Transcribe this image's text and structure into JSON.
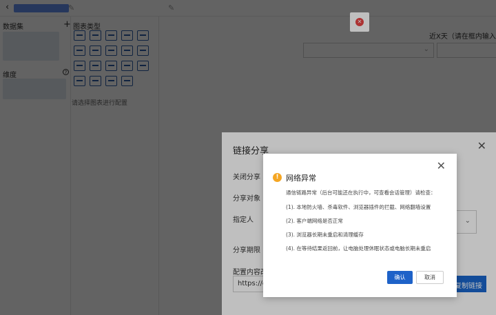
{
  "topbar": {
    "back_icon": "‹",
    "edit_icon": "✎"
  },
  "left_panel": {
    "dataset_title": "数据集",
    "add_icon": "+",
    "dimension_title": "维度",
    "help_icon": "?"
  },
  "chart_panel": {
    "title": "图表类型",
    "hint": "请选择图表进行配置",
    "chart_types": [
      "table",
      "crosstab",
      "list",
      "line",
      "bar",
      "horizontal-bar",
      "pie",
      "scatter",
      "funnel",
      "radar",
      "area",
      "gauge",
      "stacked-bar",
      "combo",
      "map",
      "ranking",
      "text",
      "kpi",
      "venn"
    ]
  },
  "main": {
    "recent_label": "近X天（请在框内输入要显",
    "select_chevron": "⌄"
  },
  "share_dialog": {
    "title": "链接分享",
    "close_icon": "✕",
    "close_share_label": "关闭分享",
    "target_label": "分享对象",
    "specify_label": "指定人",
    "period_label": "分享期限",
    "config_label": "配置内容改变",
    "url_value": "https://dm",
    "copy_button": "复制链接",
    "chevron": "⌄"
  },
  "error_dialog": {
    "title": "网络异常",
    "close_icon": "✕",
    "warn_icon": "!",
    "message": "通信链路异常（后台可能还在执行中，可查看会话管理）请检查：",
    "items": [
      "(1). 本地防火墙、杀毒软件、浏览器插件的拦截、网络翻墙设置",
      "(2). 客户端网络是否正常",
      "(3). 浏览器长期未重启和清理缓存",
      "(4). 在等待结果返回前，让电脑处理休眠状态或电脑长期未重启"
    ],
    "ok_button": "确认",
    "cancel_button": "取消"
  },
  "top_error_icon": "✕",
  "colors": {
    "primary": "#1e62c8",
    "warning": "#f5a623",
    "error": "#e64343"
  }
}
